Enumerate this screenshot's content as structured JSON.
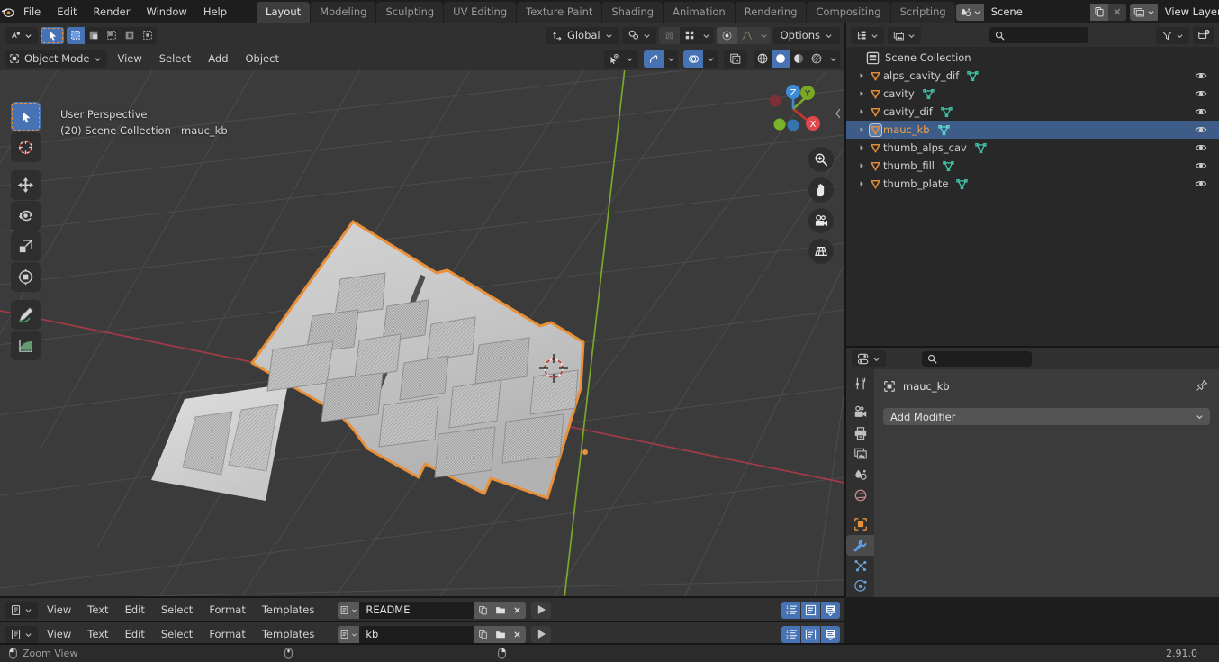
{
  "app": {
    "version": "2.91.0",
    "accent_blue": "#4772b3",
    "accent_orange": "#e8913a",
    "selected_row_blue": "#3e5c88"
  },
  "topbar": {
    "logo_icon": "blender-logo-icon",
    "menus": [
      "File",
      "Edit",
      "Render",
      "Window",
      "Help"
    ],
    "workspace_tabs": [
      {
        "label": "Layout",
        "active": true
      },
      {
        "label": "Modeling",
        "active": false
      },
      {
        "label": "Sculpting",
        "active": false
      },
      {
        "label": "UV Editing",
        "active": false
      },
      {
        "label": "Texture Paint",
        "active": false
      },
      {
        "label": "Shading",
        "active": false
      },
      {
        "label": "Animation",
        "active": false
      },
      {
        "label": "Rendering",
        "active": false
      },
      {
        "label": "Compositing",
        "active": false
      },
      {
        "label": "Scripting",
        "active": false
      }
    ],
    "scene": {
      "icon": "scene-icon",
      "value": "Scene",
      "new_icon": "new-copy-icon",
      "unlink_icon": "close-icon"
    },
    "viewlayer": {
      "icon": "view-layer-icon",
      "value": "View Layer",
      "new_icon": "new-copy-icon",
      "unlink_icon": "close-icon"
    }
  },
  "viewport": {
    "header_row1": {
      "editor_type_icon": "editor-type-3dview-icon",
      "select_tool_icon": "cursor-select-icon",
      "select_modes": [
        "select-new-icon",
        "select-extend-icon",
        "select-subtract-icon",
        "select-invert-icon",
        "select-intersect-icon"
      ],
      "transform_orientation": {
        "icon": "orientation-icon",
        "value": "Global"
      },
      "pivot_icon": "pivot-point-icon",
      "snap_icon": "magnet-icon",
      "snap_target_icon": "snap-target-icon",
      "proportional_icon": "proportional-edit-icon",
      "falloff_icon": "falloff-curve-icon",
      "options_label": "Options"
    },
    "header_row2": {
      "mode": {
        "icon": "object-mode-icon",
        "label": "Object Mode"
      },
      "menus": [
        "View",
        "Select",
        "Add",
        "Object"
      ],
      "visibility_icon": "visibility-eye-icon",
      "gizmo_icon": "gizmo-icon",
      "overlays_icon": "overlays-icon",
      "xray_icon": "xray-toggle-icon",
      "shading_modes": [
        "wireframe-shading-icon",
        "solid-shading-icon",
        "material-preview-icon",
        "rendered-shading-icon"
      ],
      "shading_active_index": 1
    },
    "overlay_line1": "User Perspective",
    "overlay_line2": "(20) Scene Collection | mauc_kb",
    "toolbar_tools": [
      {
        "name": "tweak-select-tool",
        "active": true
      },
      {
        "name": "cursor-tool",
        "active": false
      },
      {
        "name": "move-tool",
        "active": false
      },
      {
        "name": "rotate-tool",
        "active": false
      },
      {
        "name": "scale-tool",
        "active": false
      },
      {
        "name": "transform-tool",
        "active": false
      },
      {
        "name": "annotate-tool",
        "active": false
      },
      {
        "name": "measure-tool",
        "active": false
      }
    ],
    "nav_gizmo": {
      "axes": [
        "X",
        "Y",
        "Z"
      ]
    },
    "nav_buttons": [
      "zoom-view-icon",
      "move-view-icon",
      "camera-view-icon",
      "toggle-ortho-icon"
    ],
    "scene_description": "3D model of a split ergonomic keyboard plate (mauc_kb) shown selected with orange outline, plus a smaller thumb plate mesh to its lower left, on a grey floor grid with red X axis line and green Y axis line"
  },
  "outliner": {
    "header": {
      "display_mode_icon": "outliner-display-mode-icon",
      "filter_id_icon": "filter-id-type-icon",
      "search_icon": "search-icon",
      "search_value": "",
      "filter_icon": "funnel-filter-icon",
      "new_collection_icon": "new-collection-icon"
    },
    "root": {
      "icon": "scene-collection-icon",
      "label": "Scene Collection"
    },
    "items": [
      {
        "label": "alps_cavity_dif",
        "object_icon": "mesh-object-icon",
        "data_icon": "mesh-data-icon",
        "selected": false,
        "visible_icon": "eye-open-icon",
        "expand_icon": "disclosure-right-icon"
      },
      {
        "label": "cavity",
        "object_icon": "mesh-object-icon",
        "data_icon": "mesh-data-icon",
        "selected": false,
        "visible_icon": "eye-open-icon",
        "expand_icon": "disclosure-right-icon"
      },
      {
        "label": "cavity_dif",
        "object_icon": "mesh-object-icon",
        "data_icon": "mesh-data-icon",
        "selected": false,
        "visible_icon": "eye-open-icon",
        "expand_icon": "disclosure-right-icon"
      },
      {
        "label": "mauc_kb",
        "object_icon": "mesh-object-icon",
        "data_icon": "mesh-data-icon",
        "selected": true,
        "visible_icon": "eye-open-icon",
        "expand_icon": "disclosure-right-icon"
      },
      {
        "label": "thumb_alps_cav",
        "object_icon": "mesh-object-icon",
        "data_icon": "mesh-data-icon",
        "selected": false,
        "visible_icon": "eye-open-icon",
        "expand_icon": "disclosure-right-icon"
      },
      {
        "label": "thumb_fill",
        "object_icon": "mesh-object-icon",
        "data_icon": "mesh-data-icon",
        "selected": false,
        "visible_icon": "eye-open-icon",
        "expand_icon": "disclosure-right-icon"
      },
      {
        "label": "thumb_plate",
        "object_icon": "mesh-object-icon",
        "data_icon": "mesh-data-icon",
        "selected": false,
        "visible_icon": "eye-open-icon",
        "expand_icon": "disclosure-right-icon"
      }
    ]
  },
  "properties": {
    "editor_type_icon": "editor-type-properties-icon",
    "search_icon": "search-icon",
    "search_value": "",
    "tabs": [
      {
        "name": "tool-tab",
        "icon": "tool-screwdriver-wrench-icon",
        "active": false
      },
      {
        "name": "render-tab",
        "icon": "render-camera-icon",
        "active": false
      },
      {
        "name": "output-tab",
        "icon": "output-printer-icon",
        "active": false
      },
      {
        "name": "view-layer-tab",
        "icon": "view-layer-images-icon",
        "active": false
      },
      {
        "name": "scene-tab",
        "icon": "scene-cone-icon",
        "active": false
      },
      {
        "name": "world-tab",
        "icon": "world-globe-icon",
        "active": false
      },
      {
        "name": "object-tab",
        "icon": "object-square-icon",
        "active": false
      },
      {
        "name": "modifier-tab",
        "icon": "modifier-wrench-icon",
        "active": true
      },
      {
        "name": "particles-tab",
        "icon": "particles-icon",
        "active": false
      },
      {
        "name": "physics-tab",
        "icon": "physics-orbit-icon",
        "active": false
      }
    ],
    "breadcrumb": {
      "icon": "object-square-icon",
      "label": "mauc_kb",
      "pin_icon": "pin-icon"
    },
    "add_modifier_label": "Add Modifier",
    "add_modifier_chevron": "chevron-down-icon"
  },
  "text_editors": [
    {
      "editor_type_icon": "editor-type-text-icon",
      "menus": [
        "View",
        "Text",
        "Edit",
        "Select",
        "Format",
        "Templates"
      ],
      "datablock_icon": "text-datablock-icon",
      "filename": "README",
      "new_icon": "new-text-icon",
      "open_icon": "open-folder-icon",
      "unlink_icon": "close-icon",
      "run_icon": "run-script-icon",
      "toggles": [
        "line-numbers-icon",
        "word-wrap-icon",
        "syntax-highlight-icon"
      ]
    },
    {
      "editor_type_icon": "editor-type-text-icon",
      "menus": [
        "View",
        "Text",
        "Edit",
        "Select",
        "Format",
        "Templates"
      ],
      "datablock_icon": "text-datablock-icon",
      "filename": "kb",
      "new_icon": "new-text-icon",
      "open_icon": "open-folder-icon",
      "unlink_icon": "close-icon",
      "run_icon": "run-script-icon",
      "toggles": [
        "line-numbers-icon",
        "word-wrap-icon",
        "syntax-highlight-icon"
      ]
    }
  ],
  "statusbar": {
    "mouse_icon_left": "mouse-left-button-icon",
    "hint": "Zoom View",
    "mouse_icon_mid": "mouse-middle-button-icon",
    "mouse_icon_right": "mouse-right-button-icon",
    "version": "2.91.0"
  }
}
